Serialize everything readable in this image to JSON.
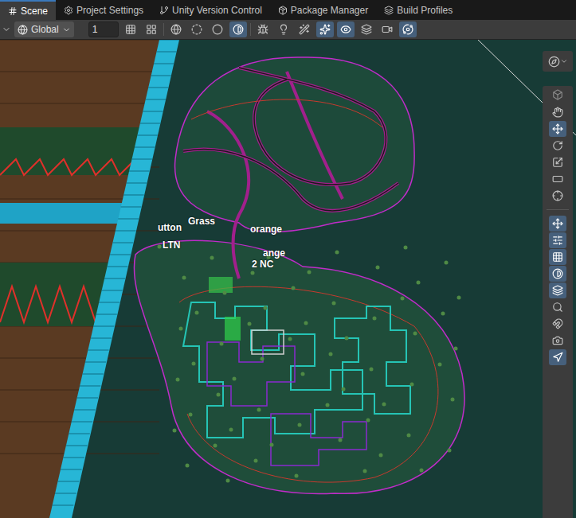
{
  "tabs": [
    {
      "label": "Scene",
      "kind": "scene",
      "selected": true
    },
    {
      "label": "Project Settings",
      "kind": "settings",
      "selected": false
    },
    {
      "label": "Unity Version Control",
      "kind": "vcs",
      "selected": false
    },
    {
      "label": "Package Manager",
      "kind": "package",
      "selected": false
    },
    {
      "label": "Build Profiles",
      "kind": "build",
      "selected": false
    }
  ],
  "toolbar": {
    "handle_rotation": "Global",
    "grid_size": "1",
    "snap_toggles": [
      {
        "kind": "grid-snap",
        "on": false
      },
      {
        "kind": "increment-snap",
        "on": false
      }
    ],
    "shading_modes": [
      {
        "kind": "wireframe",
        "selected": false
      },
      {
        "kind": "shaded-wireframe",
        "selected": false
      },
      {
        "kind": "shaded",
        "selected": false
      },
      {
        "kind": "unlit",
        "selected": true
      }
    ],
    "view_toggles": [
      {
        "kind": "debug",
        "on": false
      },
      {
        "kind": "lighting",
        "on": false
      },
      {
        "kind": "audio",
        "on": false
      },
      {
        "kind": "effects",
        "on": true
      },
      {
        "kind": "visibility",
        "on": true
      },
      {
        "kind": "layers",
        "on": false
      },
      {
        "kind": "camera",
        "on": false
      },
      {
        "kind": "gizmos",
        "on": true
      }
    ]
  },
  "tools": [
    {
      "kind": "view",
      "selected": false
    },
    {
      "kind": "move",
      "selected": true
    },
    {
      "kind": "rotate",
      "selected": false
    },
    {
      "kind": "scale",
      "selected": false
    },
    {
      "kind": "rect",
      "selected": false
    },
    {
      "kind": "transform",
      "selected": false
    }
  ],
  "overlays": [
    {
      "kind": "move",
      "on": true
    },
    {
      "kind": "sliders",
      "on": true
    },
    {
      "kind": "grid",
      "on": true
    },
    {
      "kind": "contrast",
      "on": true
    },
    {
      "kind": "layers",
      "on": true
    },
    {
      "kind": "search",
      "on": false
    },
    {
      "kind": "orbit",
      "on": false
    },
    {
      "kind": "camera",
      "on": false
    },
    {
      "kind": "navigation",
      "on": true
    }
  ],
  "scene_labels": [
    "Grass",
    "utton",
    "orange",
    "LTN",
    "ange",
    "2 NC"
  ]
}
